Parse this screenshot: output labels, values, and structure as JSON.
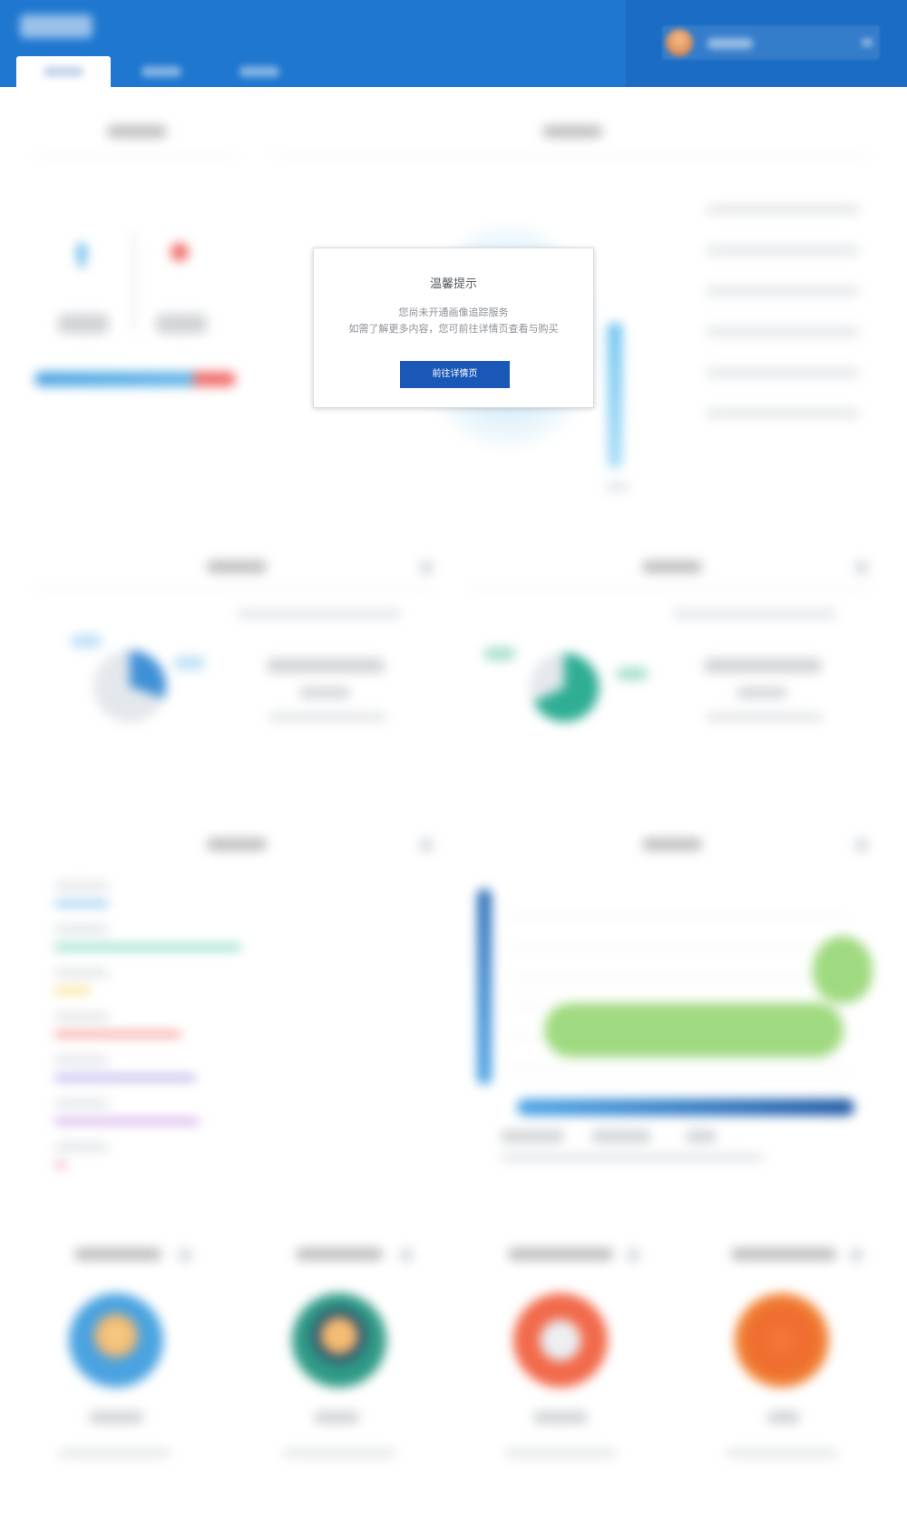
{
  "modal": {
    "title": "温馨提示",
    "line1": "您尚未开通画像追踪服务",
    "line2": "如需了解更多内容，您可前往详情页查看与购买",
    "button_label": "前往详情页"
  },
  "colors": {
    "header": "#1f77d0",
    "header_right": "#1a6cc4",
    "modal_button": "#1a58b8"
  },
  "icons": {
    "user_avatar": "avatar-icon",
    "caret": "chevron-down-icon"
  }
}
